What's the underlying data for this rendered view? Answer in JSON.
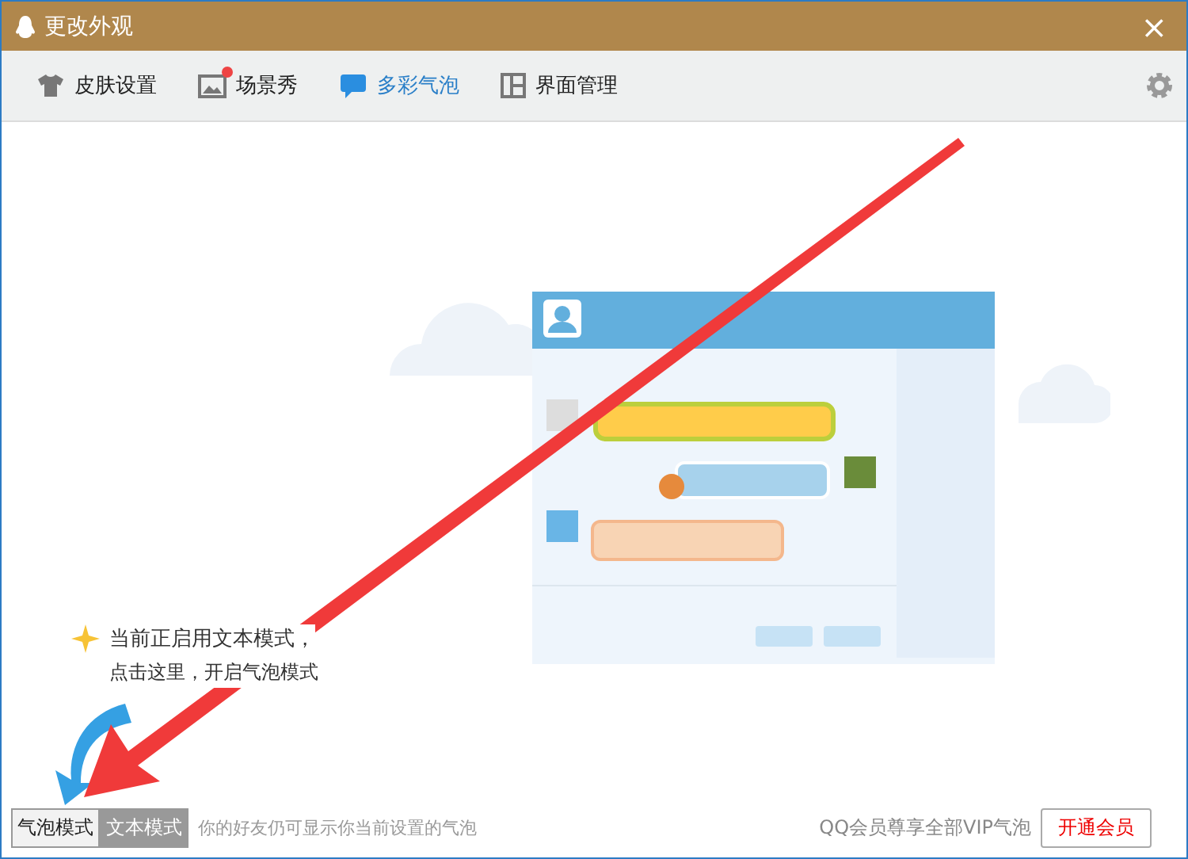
{
  "window": {
    "title": "更改外观",
    "close": "×"
  },
  "tabs": [
    {
      "label": "皮肤设置",
      "selected": false,
      "badge": false
    },
    {
      "label": "场景秀",
      "selected": false,
      "badge": true
    },
    {
      "label": "多彩气泡",
      "selected": true,
      "badge": false
    },
    {
      "label": "界面管理",
      "selected": false,
      "badge": false
    }
  ],
  "hint": {
    "line_1": "当前正启用文本模式，",
    "line_2": "点击这里，开启气泡模式"
  },
  "modes": [
    {
      "label": "气泡模式",
      "selected": false
    },
    {
      "label": "文本模式",
      "selected": true
    }
  ],
  "footer_note": "你的好友仍可显示你当前设置的气泡",
  "vip_text": "QQ会员尊享全部VIP气泡",
  "vip_button": "开通会员"
}
